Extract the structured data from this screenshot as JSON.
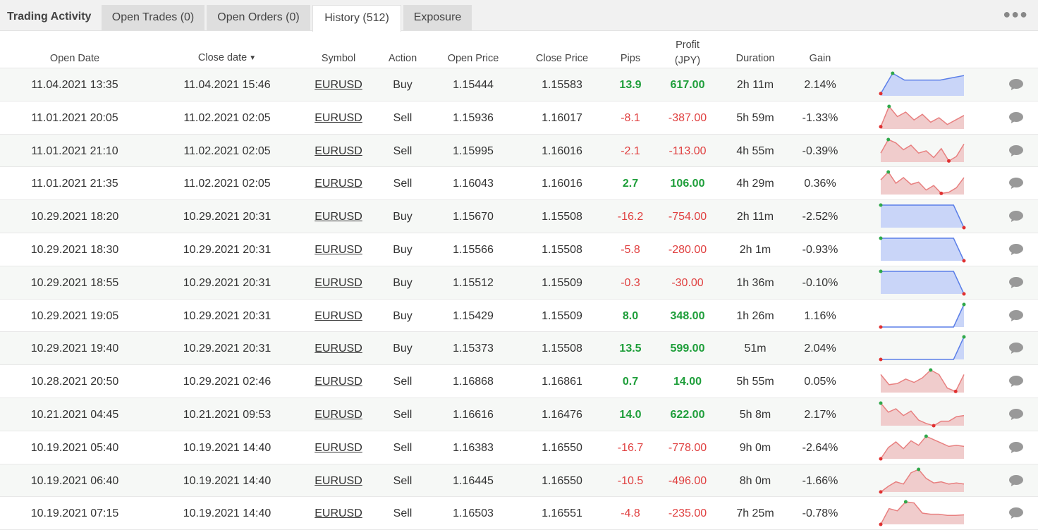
{
  "tabs": {
    "title": "Trading Activity",
    "items": [
      {
        "label": "Open Trades (0)",
        "active": false
      },
      {
        "label": "Open Orders (0)",
        "active": false
      },
      {
        "label": "History (512)",
        "active": true
      },
      {
        "label": "Exposure",
        "active": false
      }
    ],
    "more_icon": "ellipsis-icon"
  },
  "table": {
    "columns": {
      "open_date": "Open Date",
      "close_date": "Close date",
      "symbol": "Symbol",
      "action": "Action",
      "open_price": "Open Price",
      "close_price": "Close Price",
      "pips": "Pips",
      "profit_line1": "Profit",
      "profit_line2": "(JPY)",
      "duration": "Duration",
      "gain": "Gain",
      "chart_icon": "info-icon"
    },
    "rows": [
      {
        "open_date": "11.04.2021 13:35",
        "close_date": "11.04.2021 15:46",
        "symbol": "EURUSD",
        "action": "Buy",
        "open_price": "1.15444",
        "close_price": "1.15583",
        "pips": "13.9",
        "profit": "617.00",
        "duration": "2h 11m",
        "gain": "2.14%",
        "positive": true,
        "spark": [
          10,
          100,
          70,
          70,
          70,
          70,
          80,
          90
        ],
        "spark_type": "buy"
      },
      {
        "open_date": "11.01.2021 20:05",
        "close_date": "11.02.2021 02:05",
        "symbol": "EURUSD",
        "action": "Sell",
        "open_price": "1.15936",
        "close_price": "1.16017",
        "pips": "-8.1",
        "profit": "-387.00",
        "duration": "5h 59m",
        "gain": "-1.33%",
        "positive": false,
        "spark": [
          10,
          100,
          55,
          75,
          40,
          65,
          30,
          50,
          20,
          40,
          60
        ],
        "spark_type": "sell"
      },
      {
        "open_date": "11.01.2021 21:10",
        "close_date": "11.02.2021 02:05",
        "symbol": "EURUSD",
        "action": "Sell",
        "open_price": "1.15995",
        "close_price": "1.16016",
        "pips": "-2.1",
        "profit": "-113.00",
        "duration": "4h 55m",
        "gain": "-0.39%",
        "positive": false,
        "spark": [
          40,
          100,
          85,
          55,
          75,
          40,
          50,
          20,
          60,
          5,
          25,
          80
        ],
        "spark_type": "sell"
      },
      {
        "open_date": "11.01.2021 21:35",
        "close_date": "11.02.2021 02:05",
        "symbol": "EURUSD",
        "action": "Sell",
        "open_price": "1.16043",
        "close_price": "1.16016",
        "pips": "2.7",
        "profit": "106.00",
        "duration": "4h 29m",
        "gain": "0.36%",
        "positive": true,
        "spark": [
          65,
          100,
          50,
          75,
          45,
          55,
          20,
          40,
          5,
          10,
          30,
          75
        ],
        "spark_type": "sell"
      },
      {
        "open_date": "10.29.2021 18:20",
        "close_date": "10.29.2021 20:31",
        "symbol": "EURUSD",
        "action": "Buy",
        "open_price": "1.15670",
        "close_price": "1.15508",
        "pips": "-16.2",
        "profit": "-754.00",
        "duration": "2h 11m",
        "gain": "-2.52%",
        "positive": false,
        "spark": [
          100,
          100,
          100,
          100,
          100,
          100,
          100,
          100,
          0
        ],
        "spark_type": "buy"
      },
      {
        "open_date": "10.29.2021 18:30",
        "close_date": "10.29.2021 20:31",
        "symbol": "EURUSD",
        "action": "Buy",
        "open_price": "1.15566",
        "close_price": "1.15508",
        "pips": "-5.8",
        "profit": "-280.00",
        "duration": "2h 1m",
        "gain": "-0.93%",
        "positive": false,
        "spark": [
          100,
          100,
          100,
          100,
          100,
          100,
          100,
          100,
          0
        ],
        "spark_type": "buy"
      },
      {
        "open_date": "10.29.2021 18:55",
        "close_date": "10.29.2021 20:31",
        "symbol": "EURUSD",
        "action": "Buy",
        "open_price": "1.15512",
        "close_price": "1.15509",
        "pips": "-0.3",
        "profit": "-30.00",
        "duration": "1h 36m",
        "gain": "-0.10%",
        "positive": false,
        "spark": [
          100,
          100,
          100,
          100,
          100,
          100,
          100,
          100,
          0
        ],
        "spark_type": "buy"
      },
      {
        "open_date": "10.29.2021 19:05",
        "close_date": "10.29.2021 20:31",
        "symbol": "EURUSD",
        "action": "Buy",
        "open_price": "1.15429",
        "close_price": "1.15509",
        "pips": "8.0",
        "profit": "348.00",
        "duration": "1h 26m",
        "gain": "1.16%",
        "positive": true,
        "spark": [
          0,
          0,
          0,
          0,
          0,
          0,
          0,
          0,
          100
        ],
        "spark_type": "buy"
      },
      {
        "open_date": "10.29.2021 19:40",
        "close_date": "10.29.2021 20:31",
        "symbol": "EURUSD",
        "action": "Buy",
        "open_price": "1.15373",
        "close_price": "1.15508",
        "pips": "13.5",
        "profit": "599.00",
        "duration": "51m",
        "gain": "2.04%",
        "positive": true,
        "spark": [
          0,
          0,
          0,
          0,
          0,
          0,
          0,
          0,
          100
        ],
        "spark_type": "buy"
      },
      {
        "open_date": "10.28.2021 20:50",
        "close_date": "10.29.2021 02:46",
        "symbol": "EURUSD",
        "action": "Sell",
        "open_price": "1.16868",
        "close_price": "1.16861",
        "pips": "0.7",
        "profit": "14.00",
        "duration": "5h 55m",
        "gain": "0.05%",
        "positive": true,
        "spark": [
          80,
          35,
          40,
          60,
          45,
          65,
          100,
          80,
          20,
          5,
          80
        ],
        "spark_type": "sell"
      },
      {
        "open_date": "10.21.2021 04:45",
        "close_date": "10.21.2021 09:53",
        "symbol": "EURUSD",
        "action": "Sell",
        "open_price": "1.16616",
        "close_price": "1.16476",
        "pips": "14.0",
        "profit": "622.00",
        "duration": "5h 8m",
        "gain": "2.17%",
        "positive": true,
        "spark": [
          100,
          60,
          75,
          45,
          65,
          25,
          10,
          0,
          20,
          20,
          40,
          45
        ],
        "spark_type": "sell"
      },
      {
        "open_date": "10.19.2021 05:40",
        "close_date": "10.19.2021 14:40",
        "symbol": "EURUSD",
        "action": "Sell",
        "open_price": "1.16383",
        "close_price": "1.16550",
        "pips": "-16.7",
        "profit": "-778.00",
        "duration": "9h 0m",
        "gain": "-2.64%",
        "positive": false,
        "spark": [
          0,
          50,
          75,
          45,
          80,
          60,
          100,
          85,
          70,
          55,
          60,
          55
        ],
        "spark_type": "sell"
      },
      {
        "open_date": "10.19.2021 06:40",
        "close_date": "10.19.2021 14:40",
        "symbol": "EURUSD",
        "action": "Sell",
        "open_price": "1.16445",
        "close_price": "1.16550",
        "pips": "-10.5",
        "profit": "-496.00",
        "duration": "8h 0m",
        "gain": "-1.66%",
        "positive": false,
        "spark": [
          0,
          25,
          45,
          35,
          85,
          100,
          60,
          40,
          45,
          35,
          40,
          35
        ],
        "spark_type": "sell"
      },
      {
        "open_date": "10.19.2021 07:15",
        "close_date": "10.19.2021 14:40",
        "symbol": "EURUSD",
        "action": "Sell",
        "open_price": "1.16503",
        "close_price": "1.16551",
        "pips": "-4.8",
        "profit": "-235.00",
        "duration": "7h 25m",
        "gain": "-0.78%",
        "positive": false,
        "spark": [
          0,
          70,
          60,
          100,
          95,
          50,
          45,
          45,
          40,
          40,
          42
        ],
        "spark_type": "sell"
      }
    ]
  },
  "colors": {
    "positive": "#1e9e3a",
    "negative": "#e04040",
    "buy_line": "#5b7fe8",
    "buy_fill": "#c9d5f8",
    "sell_line": "#e88080",
    "sell_fill": "#f0cccc",
    "high_dot": "#2fa84a",
    "low_dot": "#e03030"
  }
}
